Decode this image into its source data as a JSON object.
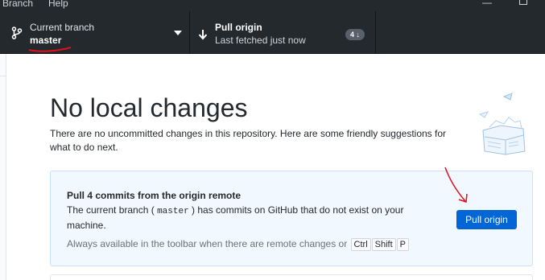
{
  "menu": {
    "items": [
      "Branch",
      "Help"
    ]
  },
  "toolbar": {
    "branch": {
      "title": "Current branch",
      "value": "master"
    },
    "pull": {
      "title": "Pull origin",
      "subtitle": "Last fetched just now",
      "badge": "4"
    }
  },
  "main": {
    "heading": "No local changes",
    "description": "There are no uncommitted changes in this repository. Here are some friendly suggestions for what to do next.",
    "card": {
      "title": "Pull 4 commits from the origin remote",
      "description_before": "The current branch (",
      "branch_code": "master",
      "description_after": ") has commits on GitHub that do not exist on your machine.",
      "hint": "Always available in the toolbar when there are remote changes or",
      "shortcut": [
        "Ctrl",
        "Shift",
        "P"
      ],
      "button_label": "Pull origin"
    }
  },
  "icons": {
    "branch": "branch-icon",
    "dropdown": "chevron-down-icon",
    "pull": "arrow-down-icon",
    "badge_arrow": "arrow-up-icon"
  },
  "colors": {
    "toolbar_bg": "#24292e",
    "primary_button": "#0366d6",
    "card_bg": "#f1f8ff",
    "card_border": "#c8e1ff",
    "annotation": "#e0101a"
  }
}
